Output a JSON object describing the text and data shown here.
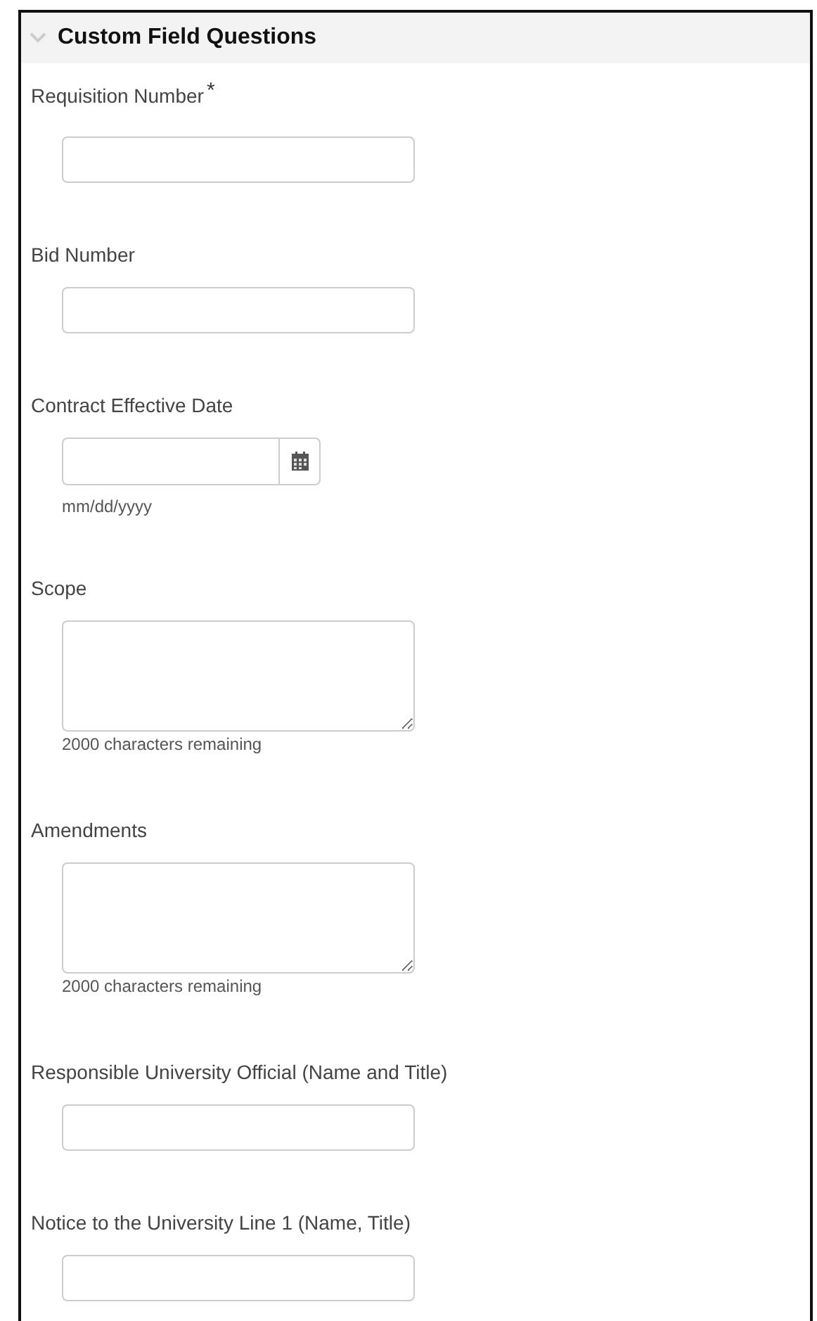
{
  "section": {
    "title": "Custom Field Questions",
    "expanded": true
  },
  "fields": [
    {
      "kind": "text",
      "label": "Requisition Number",
      "required_mark": "*"
    },
    {
      "kind": "text",
      "label": "Bid Number"
    },
    {
      "kind": "date",
      "label": "Contract Effective Date",
      "hint": "mm/dd/yyyy"
    },
    {
      "kind": "textarea",
      "label": "Scope",
      "hint": "2000 characters remaining"
    },
    {
      "kind": "textarea",
      "label": "Amendments",
      "hint": "2000 characters remaining"
    },
    {
      "kind": "text",
      "label": "Responsible University Official (Name and Title)"
    },
    {
      "kind": "text",
      "label": "Notice to the University Line 1 (Name, Title)"
    }
  ]
}
